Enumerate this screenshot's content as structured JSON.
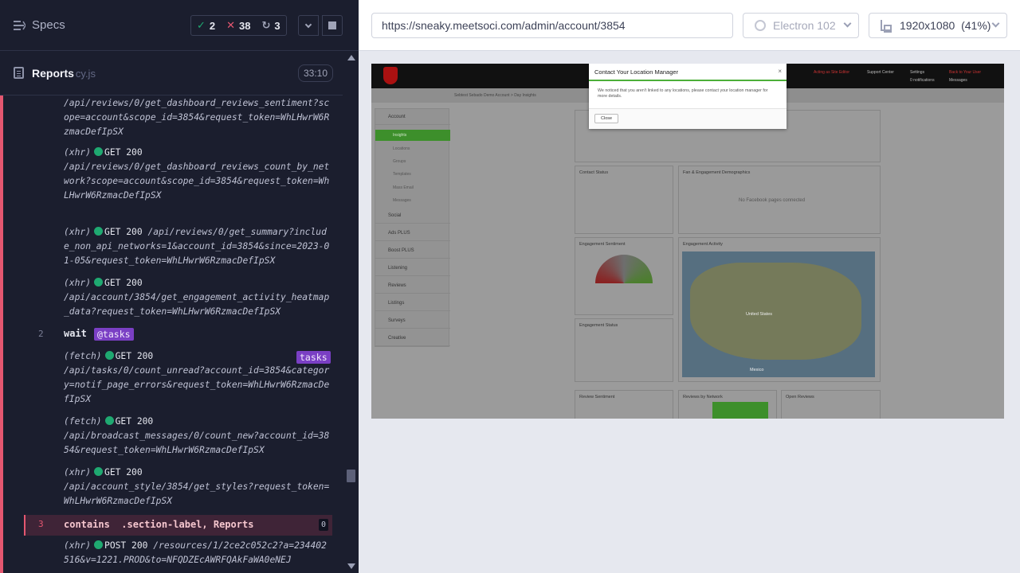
{
  "reporter": {
    "specs_label": "Specs",
    "stats": {
      "passed": "2",
      "failed": "38",
      "pending": "3"
    }
  },
  "file": {
    "name": "Reports",
    "ext": "cy.js",
    "duration": "33:10"
  },
  "log": {
    "entries": [
      {
        "type": "",
        "method": "",
        "text": "/api/reviews/0/get_dashboard_reviews_sentiment?scope=account&scope_id=3854&request_token=WhLHwrW6RzmacDefIpSX"
      },
      {
        "type": "(xhr)",
        "method": "GET 200",
        "text": "/api/reviews/0/get_dashboard_reviews_count_by_network?scope=account&scope_id=3854&request_token=WhLHwrW6RzmacDefIpSX"
      },
      {
        "type": "(xhr)",
        "method": "GET 200",
        "text": "/api/reviews/0/get_summary?include_non_api_networks=1&account_id=3854&since=2023-01-05&request_token=WhLHwrW6RzmacDefIpSX"
      },
      {
        "type": "(xhr)",
        "method": "GET 200",
        "text": "/api/account/3854/get_engagement_activity_heatmap_data?request_token=WhLHwrW6RzmacDefIpSX"
      },
      {
        "type": "(fetch)",
        "method": "GET 200",
        "text": "/api/tasks/0/count_unread?account_id=3854&category=notif_page_errors&request_token=WhLHwrW6RzmacDefIpSX"
      },
      {
        "type": "(fetch)",
        "method": "GET 200",
        "text": "/api/broadcast_messages/0/count_new?account_id=3854&request_token=WhLHwrW6RzmacDefIpSX"
      },
      {
        "type": "(xhr)",
        "method": "GET 200",
        "text": "/api/account_style/3854/get_styles?request_token=WhLHwrW6RzmacDefIpSX"
      },
      {
        "type": "(xhr)",
        "method": "POST 200",
        "text": "/resources/1/2ce2c052c2?a=234402516&v=1221.PROD&to=NFQDZEcAWRFQAkFaWA0eNEJ"
      }
    ],
    "wait_cmd": {
      "num": "2",
      "name": "wait",
      "alias": "@tasks",
      "tag": "tasks"
    },
    "contains_cmd": {
      "num": "3",
      "name": "contains",
      "selector": ".section-label, Reports",
      "count": "0"
    }
  },
  "browser": {
    "url": "https://sneaky.meetsoci.com/admin/account/3854",
    "browser_name": "Electron 102",
    "viewport": "1920x1080",
    "scale": "(41%)"
  },
  "aut": {
    "modal": {
      "title": "Contact Your Location Manager",
      "body": "We noticed that you aren't linked to any locations, please contact your location manager for more details.",
      "close_button": "Close"
    },
    "sidebar": [
      "Account",
      "Social",
      "Ads PLUS",
      "Boost PLUS",
      "Listening",
      "Reviews",
      "Listings",
      "Surveys",
      "Creative"
    ],
    "account_sub": [
      "Insights",
      "Locations",
      "Groups",
      "Templates",
      "Mass Email",
      "Messages"
    ],
    "nav": [
      "Acting as Site Editor",
      "Support Center",
      "Settings",
      "Back to Your User",
      "0 notifications",
      "Messages"
    ],
    "breadcrumb": "Sebtest Sebado Demo Account > Day Insights",
    "cards": [
      "Contact Status",
      "Fan & Engagement Demographics",
      "Engagement Sentiment",
      "Engagement Activity",
      "Engagement Status",
      "Review Sentiment",
      "Reviews by Network",
      "Open Reviews"
    ],
    "no_pages": "No Facebook pages connected",
    "map_labels": [
      "United States",
      "Mexico"
    ]
  }
}
